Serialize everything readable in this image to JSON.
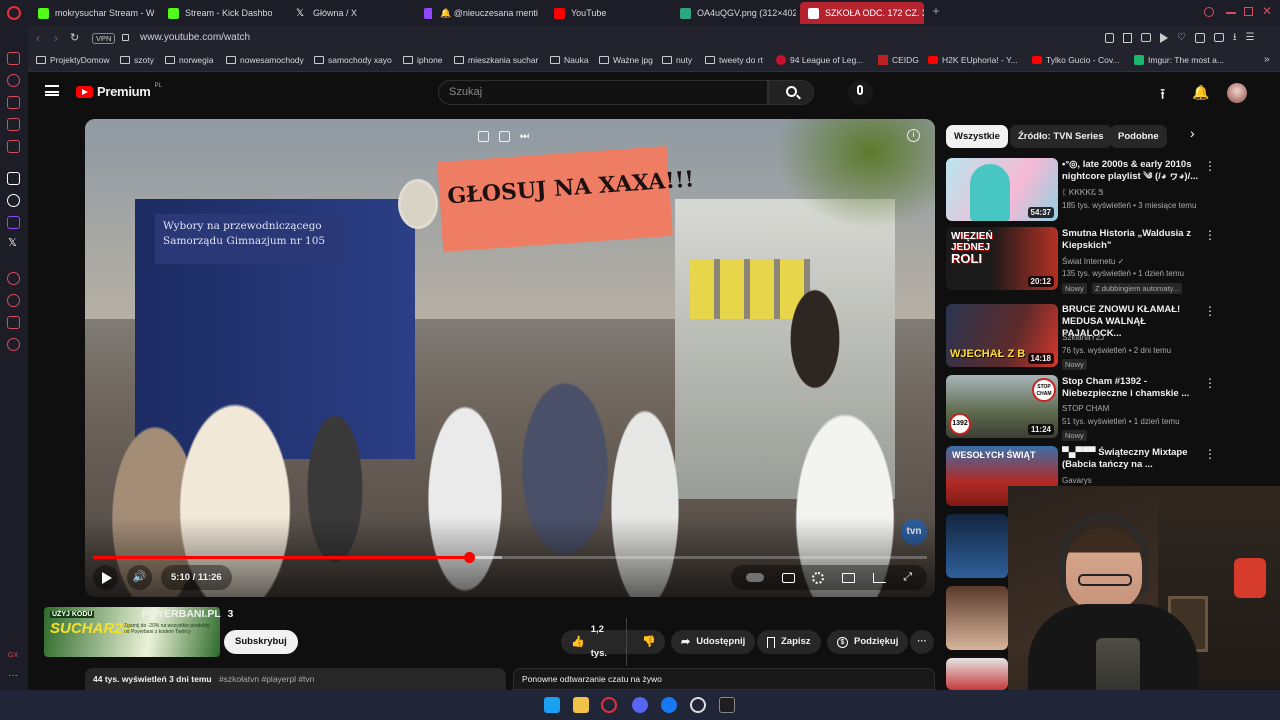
{
  "browser": {
    "tabs": [
      {
        "label": "mokrysuchar Stream - W",
        "color": "#53fc18"
      },
      {
        "label": "Stream - Kick Dashbo",
        "color": "#53fc18"
      },
      {
        "label": "Główna / X",
        "color": "#ffffff"
      },
      {
        "label": "",
        "color": "#9146ff"
      },
      {
        "label": "🔔 @nieuczesana menti",
        "color": "#9146ff"
      },
      {
        "label": "YouTube",
        "color": "#ff0000"
      },
      {
        "label": "OA4uQGV.png (312×402)",
        "color": "#2aa87e"
      },
      {
        "label": "SZKOŁA ODC. 172 CZ. 3",
        "color": "#ff0000"
      }
    ],
    "vpn_label": "VPN",
    "url": "www.youtube.com/watch",
    "bookmarks": [
      "ProjektyDomow",
      "szoty",
      "norwegia",
      "nowesamochody",
      "samochody xayo",
      "iphone",
      "mieszkania suchar",
      "Nauka",
      "Ważne jpg",
      "nuty",
      "tweety do rt",
      "94 League of Leg...",
      "CEIDG",
      "H2K EUphoria! - Y...",
      "Tylko Gucio - Cov...",
      "Imgur: The most a..."
    ]
  },
  "youtube": {
    "logo_text": "Premium",
    "logo_sup": "PL",
    "search_placeholder": "Szukaj",
    "player": {
      "time": "5:10 / 11:26",
      "progress": 0.451,
      "buffered": 0.49,
      "watermark": "tvn",
      "scene": {
        "banner_text": "GŁOSUJ NA XAXA!!!",
        "sign_line1": "Wybory na przewodniczącego",
        "sign_line2": "Samorządu Gimnazjum nr 105"
      }
    },
    "channel": {
      "name": "POYERBANI.PL",
      "suffix": "3",
      "promo_line1": "UŻYJ KODU",
      "promo_code": "SUCHAR20",
      "promo_line2": "Zgarnij do -20% na wszystkie produkty od Poyerbani z kodem Twórcy",
      "subscribe": "Subskrybuj"
    },
    "actions": {
      "likes": "1,2 tys.",
      "share": "Udostępnij",
      "save": "Zapisz",
      "thanks": "Podziękuj"
    },
    "description_meta": "44 tys. wyświetleń  3 dni temu",
    "description_tags": "#szkołatvn #playerpl #tvn",
    "chat_replay": "Ponowne odtwarzanie czatu na żywo",
    "chips": [
      "Wszystkie",
      "Źródło: TVN Series",
      "Podobne"
    ],
    "recommendations": [
      {
        "title": "•°◎, late 2000s & early 2010s nightcore playlist ༄ (/◕ ヮ◕)/...",
        "channel": "ᛕ ᏦᏦᏦᏦᏋ Ꮥ",
        "meta": "185 tys. wyświetleń • 3 miesiące temu",
        "duration": "54:37",
        "badges": []
      },
      {
        "title": "Smutna Historia „Waldusia z Kiepskich\"",
        "channel": "Świat Internetu ✓",
        "meta": "135 tys. wyświetleń • 1 dzień temu",
        "duration": "20:12",
        "badges": [
          "Nowy",
          "Z dubbingiem automaty..."
        ]
      },
      {
        "title": "BRUCE ZNOWU KŁAMAŁ! MEDUSA WALNĄŁ PAJALOCK...",
        "channel": "SzklanaY2J",
        "meta": "76 tys. wyświetleń • 2 dni temu",
        "duration": "14:18",
        "badges": [
          "Nowy"
        ]
      },
      {
        "title": "Stop Cham #1392 - Niebezpieczne i chamskie ...",
        "channel": "STOP CHAM",
        "meta": "51 tys. wyświetleń • 1 dzień temu",
        "duration": "11:24",
        "badges": [
          "Nowy"
        ]
      },
      {
        "title": "▀▄▀▀▀ Świąteczny Mixtape (Babcia tańczy na ...",
        "channel": "Gavarys",
        "meta": "",
        "duration": "",
        "badges": []
      }
    ],
    "thumb_texts": {
      "t2_line1": "WIĘZIEŃ",
      "t2_line2": "JEDNEJ",
      "t2_line3": "ROLI",
      "t3_text": "WJECHAŁ Z B",
      "t4_badge": "1392",
      "t4_sign": "STOP CHAM",
      "t5_text": "WESOŁYCH ŚWIĄT"
    }
  }
}
